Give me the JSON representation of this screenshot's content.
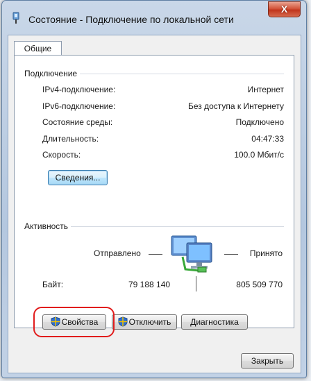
{
  "window": {
    "title": "Состояние - Подключение по локальной сети",
    "close_label": "X"
  },
  "tabs": [
    {
      "label": "Общие",
      "selected": true
    }
  ],
  "connection": {
    "heading": "Подключение",
    "rows": [
      {
        "key": "IPv4-подключение:",
        "value": "Интернет"
      },
      {
        "key": "IPv6-подключение:",
        "value": "Без доступа к Интернету"
      },
      {
        "key": "Состояние среды:",
        "value": "Подключено"
      },
      {
        "key": "Длительность:",
        "value": "04:47:33"
      },
      {
        "key": "Скорость:",
        "value": "100.0 Мбит/с"
      }
    ],
    "details_button": "Сведения..."
  },
  "activity": {
    "heading": "Активность",
    "sent_label": "Отправлено",
    "received_label": "Принято",
    "bytes_label": "Байт:",
    "bytes_sent": "79 188 140",
    "bytes_received": "805 509 770"
  },
  "buttons": {
    "properties": "Свойства",
    "disable": "Отключить",
    "diagnose": "Диагностика",
    "close": "Закрыть"
  },
  "colors": {
    "highlight": "#e11c1c",
    "shield_blue": "#2f6fd1",
    "shield_yellow": "#f2c200"
  },
  "icons": {
    "title": "network-adapter-icon",
    "activity": "network-computers-icon",
    "shield": "uac-shield-icon"
  }
}
